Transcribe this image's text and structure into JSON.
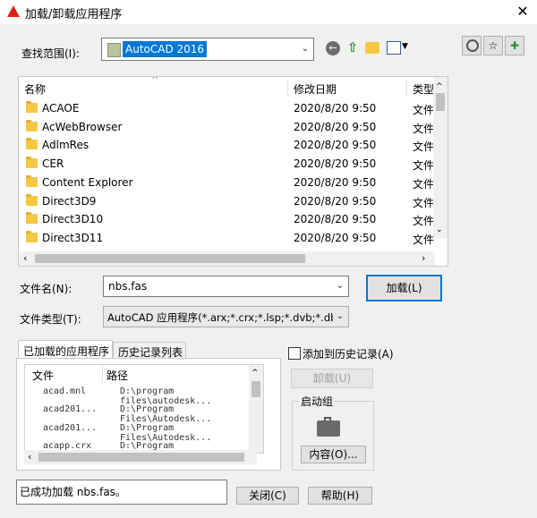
{
  "window": {
    "title": "加载/卸载应用程序",
    "close_glyph": "✕"
  },
  "lookin": {
    "label": "查找范围(I):",
    "value": "AutoCAD 2016"
  },
  "columns": {
    "name": "名称",
    "date": "修改日期",
    "type": "类型"
  },
  "files": [
    {
      "name": "ACAOE",
      "date": "2020/8/20 9:50",
      "type": "文件"
    },
    {
      "name": "AcWebBrowser",
      "date": "2020/8/20 9:50",
      "type": "文件"
    },
    {
      "name": "AdlmRes",
      "date": "2020/8/20 9:50",
      "type": "文件"
    },
    {
      "name": "CER",
      "date": "2020/8/20 9:50",
      "type": "文件"
    },
    {
      "name": "Content Explorer",
      "date": "2020/8/20 9:50",
      "type": "文件"
    },
    {
      "name": "Direct3D9",
      "date": "2020/8/20 9:50",
      "type": "文件"
    },
    {
      "name": "Direct3D10",
      "date": "2020/8/20 9:50",
      "type": "文件"
    },
    {
      "name": "Direct3D11",
      "date": "2020/8/20 9:50",
      "type": "文件"
    }
  ],
  "filename": {
    "label": "文件名(N):",
    "value": "nbs.fas"
  },
  "filetype": {
    "label": "文件类型(T):",
    "value": "AutoCAD 应用程序(*.arx;*.crx;*.lsp;*.dvb;*.dbx"
  },
  "load_button": "加载(L)",
  "tabs": {
    "loaded": "已加载的应用程序",
    "history": "历史记录列表"
  },
  "add_history": "添加到历史记录(A)",
  "unload_button": "卸载(U)",
  "startup": {
    "label": "启动组",
    "contents_button": "内容(O)..."
  },
  "loaded_columns": {
    "file": "文件",
    "path": "路径"
  },
  "loaded_apps": [
    {
      "file": "acad.mnl",
      "path": "D:\\program files\\autodesk..."
    },
    {
      "file": "acad201...",
      "path": "D:\\Program Files\\Autodesk..."
    },
    {
      "file": "acad201...",
      "path": "D:\\Program Files\\Autodesk..."
    },
    {
      "file": "acapp.crx",
      "path": "D:\\Program Files\\Autodesk..."
    }
  ],
  "status_text": "已成功加载 nbs.fas。",
  "close_button": "关闭(C)",
  "help_button": "帮助(H)",
  "colors": {
    "selection": "#0078d7",
    "accent_red": "#d9231d"
  }
}
